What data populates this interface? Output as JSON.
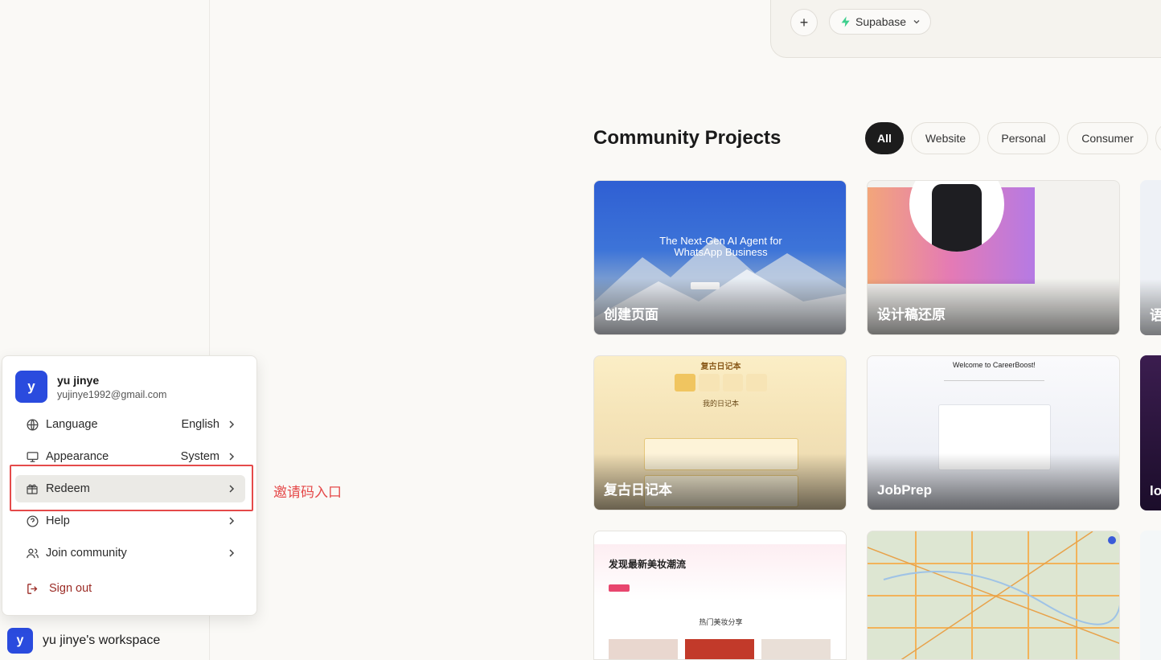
{
  "sidebar": {
    "workspace": {
      "avatar_letter": "y",
      "name": "yu jinye's workspace"
    }
  },
  "menu": {
    "user": {
      "avatar_letter": "y",
      "name": "yu jinye",
      "email": "yujinye1992@gmail.com"
    },
    "items": [
      {
        "label": "Language",
        "value": "English",
        "icon": "globe-icon"
      },
      {
        "label": "Appearance",
        "value": "System",
        "icon": "monitor-icon"
      },
      {
        "label": "Redeem",
        "value": "",
        "icon": "gift-icon"
      },
      {
        "label": "Help",
        "value": "",
        "icon": "help-circle-icon"
      },
      {
        "label": "Join community",
        "value": "",
        "icon": "users-icon"
      }
    ],
    "signout_label": "Sign out"
  },
  "annotation": {
    "text": "邀请码入口",
    "color": "#e54a4a"
  },
  "prompt": {
    "plus_label": "+",
    "integration_label": "Supabase",
    "integration_color": "#3ecf8e"
  },
  "community": {
    "title": "Community Projects",
    "filters": [
      "All",
      "Website",
      "Personal",
      "Consumer"
    ],
    "active_filter": "All",
    "cards": [
      {
        "label": "创建页面",
        "preview_title": "The Next-Gen AI Agent for WhatsApp Business"
      },
      {
        "label": "设计稿还原"
      },
      {
        "label": "复古日记本",
        "preview_title": "复古日记本",
        "preview_subtitle": "我的日记本"
      },
      {
        "label": "JobPrep",
        "preview_title": "Welcome to CareerBoost!"
      },
      {
        "label": "",
        "preview_title": "发现最新美妆潮流",
        "preview_subtitle": "热门美妆分享"
      },
      {
        "label": ""
      }
    ],
    "peek_labels": [
      "语",
      "lo"
    ]
  },
  "colors": {
    "accent": "#2a4bde",
    "background": "#faf9f6",
    "signout": "#9b2b25"
  }
}
